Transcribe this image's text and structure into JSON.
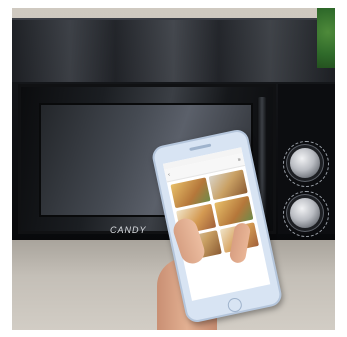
{
  "image": {
    "scene": "microwave-with-phone-app",
    "brand_text": "CANDY",
    "panel_text": "",
    "app_title": ""
  },
  "colors": {
    "microwave": "#0e0f12",
    "phone": "#d8e4f3",
    "countertop": "#c4bfb7"
  },
  "icons": [
    "back-arrow-icon",
    "menu-icon",
    "home-button-icon"
  ]
}
